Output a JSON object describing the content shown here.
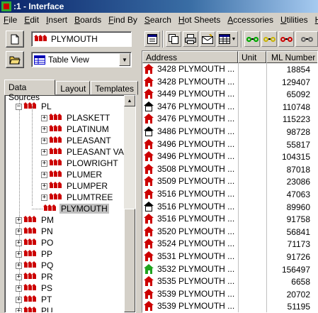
{
  "window": {
    "title": ":1 - Interface"
  },
  "menu": [
    "File",
    "Edit",
    "Insert",
    "Boards",
    "Find By",
    "Search",
    "Hot Sheets",
    "Accessories",
    "Utilities",
    "Help"
  ],
  "left": {
    "street_value": "PLYMOUTH",
    "view_value": "Table View",
    "tabs": [
      "Data Sources",
      "Layout",
      "Templates"
    ],
    "active_tab": "Data Sources"
  },
  "tree": {
    "top_node": "PL",
    "children": [
      "PLASKETT",
      "PLATINUM",
      "PLEASANT",
      "PLEASANT VALI",
      "PLOWRIGHT",
      "PLUMER",
      "PLUMPER",
      "PLUMTREE",
      "PLYMOUTH"
    ],
    "selected": "PLYMOUTH",
    "siblings": [
      "PM",
      "PN",
      "PO",
      "PP",
      "PQ",
      "PR",
      "PS",
      "PT",
      "PU"
    ]
  },
  "grid": {
    "columns": [
      "Address",
      "Unit",
      "ML Number"
    ],
    "rows": [
      {
        "address": "3428 PLYMOUTH ...",
        "ml": "18854",
        "status": "red"
      },
      {
        "address": "3428 PLYMOUTH ...",
        "ml": "129407",
        "status": "red"
      },
      {
        "address": "3449 PLYMOUTH ...",
        "ml": "65092",
        "status": "red"
      },
      {
        "address": "3476 PLYMOUTH ...",
        "ml": "110748",
        "status": "white"
      },
      {
        "address": "3476 PLYMOUTH ...",
        "ml": "115223",
        "status": "red"
      },
      {
        "address": "3486 PLYMOUTH ...",
        "ml": "98728",
        "status": "white"
      },
      {
        "address": "3496 PLYMOUTH ...",
        "ml": "55817",
        "status": "red"
      },
      {
        "address": "3496 PLYMOUTH ...",
        "ml": "104315",
        "status": "red"
      },
      {
        "address": "3508 PLYMOUTH ...",
        "ml": "87018",
        "status": "red"
      },
      {
        "address": "3509 PLYMOUTH ...",
        "ml": "23086",
        "status": "red"
      },
      {
        "address": "3516 PLYMOUTH ...",
        "ml": "47063",
        "status": "red"
      },
      {
        "address": "3516 PLYMOUTH ...",
        "ml": "89960",
        "status": "white"
      },
      {
        "address": "3516 PLYMOUTH ...",
        "ml": "91758",
        "status": "red"
      },
      {
        "address": "3520 PLYMOUTH ...",
        "ml": "56841",
        "status": "red"
      },
      {
        "address": "3524 PLYMOUTH ...",
        "ml": "71173",
        "status": "red"
      },
      {
        "address": "3531 PLYMOUTH ...",
        "ml": "91726",
        "status": "red"
      },
      {
        "address": "3532 PLYMOUTH ...",
        "ml": "156497",
        "status": "green"
      },
      {
        "address": "3535 PLYMOUTH ...",
        "ml": "6658",
        "status": "red"
      },
      {
        "address": "3539 PLYMOUTH ...",
        "ml": "20702",
        "status": "red"
      },
      {
        "address": "3539 PLYMOUTH ...",
        "ml": "51195",
        "status": "red"
      }
    ]
  },
  "colors": {
    "red": "#cc0000",
    "white": "#ffffff",
    "green": "#1fa31f",
    "titlebar": "#0a246a"
  }
}
